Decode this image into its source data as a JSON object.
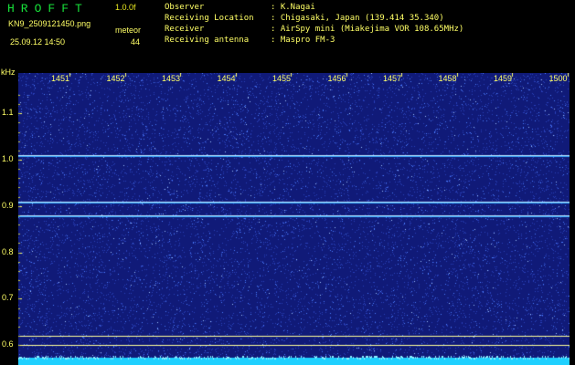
{
  "header": {
    "app_title": "HROFFT",
    "app_version": "1.0.0f",
    "file_name": "KN9_2509121450.png",
    "datetime": "25.09.12 14:50",
    "meteor_label": "meteor",
    "meteor_count": "44"
  },
  "station_info": [
    {
      "key": "Observer",
      "value": ": K.Nagai"
    },
    {
      "key": "Receiving Location",
      "value": ": Chigasaki, Japan (139.414 35.340)"
    },
    {
      "key": "Receiver",
      "value": ": AirSpy mini (Miakejima VOR 108.65MHz)"
    },
    {
      "key": "Receiving antenna",
      "value": ": Maspro FM-3"
    }
  ],
  "chart_data": {
    "type": "heatmap",
    "title": "",
    "xlabel": "",
    "ylabel": "kHz",
    "x_ticks": [
      "1451",
      "1452",
      "1453",
      "1454",
      "1455",
      "1456",
      "1457",
      "1458",
      "1459",
      "1500"
    ],
    "y_ticks": [
      "1.1",
      "1.0",
      "0.9",
      "0.8",
      "0.7",
      "0.6"
    ],
    "y_range_khz": [
      0.58,
      1.16
    ],
    "carrier_lines_khz": [
      1.01,
      0.91,
      0.88
    ],
    "reference_lines_khz": [
      0.62,
      0.6
    ],
    "background_color": "#101a78",
    "noise_color": "#4a7cff",
    "carrier_color": "#2fa8ff",
    "reference_color": "#ffff99",
    "bottom_band_color": "#1fd0ff"
  }
}
